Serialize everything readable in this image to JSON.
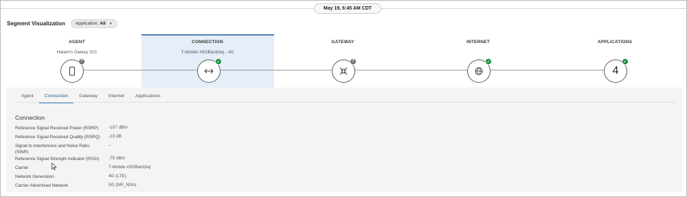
{
  "timestamp": "May 19, 6:45 AM CDT",
  "header": {
    "title": "Segment Visualization",
    "filter_label": "Application:",
    "filter_value": "All"
  },
  "segments": [
    {
      "label": "AGENT",
      "sub": "Hatam's Galaxy S21",
      "icon": "phone-icon",
      "status": "unknown"
    },
    {
      "label": "CONNECTION",
      "sub": "T-Mobile #5GBardziej - 4G",
      "icon": "arrows-horizontal-icon",
      "status": "ok"
    },
    {
      "label": "GATEWAY",
      "sub": "",
      "icon": "compress-icon",
      "status": "unknown"
    },
    {
      "label": "INTERNET",
      "sub": "",
      "icon": "globe-icon",
      "status": "ok"
    },
    {
      "label": "APPLICATIONS",
      "sub": "",
      "icon": "count",
      "value": "4",
      "status": "ok"
    }
  ],
  "status_colors": {
    "ok": "#1e8a3c",
    "unknown": "#6e6e6e",
    "selected_bg": "#e6eef9"
  },
  "tabs": [
    "Agent",
    "Connection",
    "Gateway",
    "Internet",
    "Applications"
  ],
  "active_tab": "Connection",
  "details": {
    "title": "Connection",
    "rows": [
      {
        "label": "Reference Signal Received Power (RSRP)",
        "value": "-107 dBm"
      },
      {
        "label": "Reference Signal Received Quality (RSRQ)",
        "value": "-13 dB"
      },
      {
        "label": "Signal to Interference and Noise Ratio (SINR)",
        "value": "–"
      },
      {
        "label": "Reference Signal Strength Indicator (RSSI)",
        "value": "-75 dBm"
      },
      {
        "label": "Carrier",
        "value": "T-Mobile #5GBardziej"
      },
      {
        "label": "Network Generation",
        "value": "4G (LTE)"
      },
      {
        "label": "Carrier-Advertised Network",
        "value": "5G (NR_NSA)"
      }
    ]
  }
}
